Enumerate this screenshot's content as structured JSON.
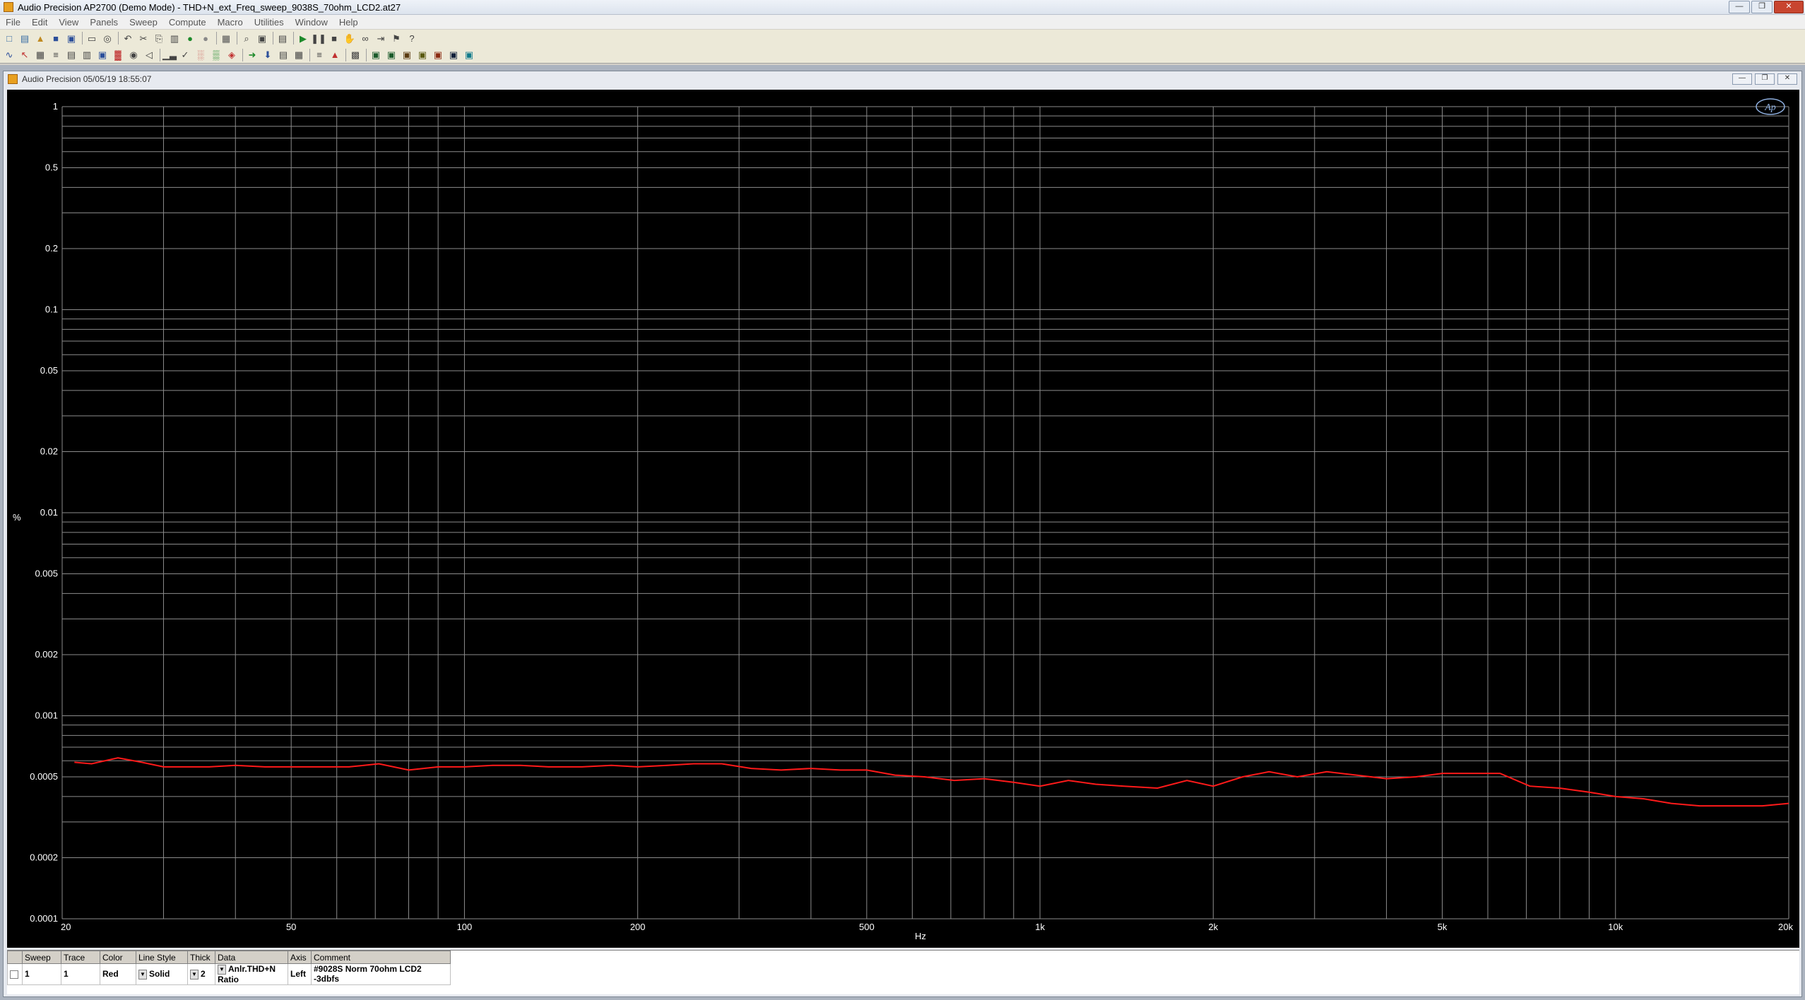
{
  "app": {
    "title": "Audio Precision AP2700 (Demo Mode) - THD+N_ext_Freq_sweep_9038S_70ohm_LCD2.at27",
    "window_buttons": [
      "—",
      "❐",
      "✕"
    ]
  },
  "menu": [
    "File",
    "Edit",
    "View",
    "Panels",
    "Sweep",
    "Compute",
    "Macro",
    "Utilities",
    "Window",
    "Help"
  ],
  "toolbar1": [
    {
      "name": "new-icon",
      "glyph": "□",
      "color": "#3a6ea5"
    },
    {
      "name": "open-settings-icon",
      "glyph": "▤",
      "color": "#3a6ea5"
    },
    {
      "name": "open-icon",
      "glyph": "▲",
      "color": "#c08a20"
    },
    {
      "name": "save-icon",
      "glyph": "■",
      "color": "#2c4f9a"
    },
    {
      "name": "save-all-icon",
      "glyph": "▣",
      "color": "#2c4f9a"
    },
    {
      "sep": true
    },
    {
      "name": "print-icon",
      "glyph": "▭",
      "color": "#444"
    },
    {
      "name": "print-preview-icon",
      "glyph": "◎",
      "color": "#444"
    },
    {
      "sep": true
    },
    {
      "name": "undo-icon",
      "glyph": "↶",
      "color": "#444"
    },
    {
      "name": "cut-icon",
      "glyph": "✂",
      "color": "#444"
    },
    {
      "name": "copy-icon",
      "glyph": "⎘",
      "color": "#444"
    },
    {
      "name": "paste-icon",
      "glyph": "▥",
      "color": "#444"
    },
    {
      "name": "generator-on-icon",
      "glyph": "●",
      "color": "#1d8a2a"
    },
    {
      "name": "generator-off-icon",
      "glyph": "●",
      "color": "#888"
    },
    {
      "sep": true
    },
    {
      "name": "panel-icon",
      "glyph": "▦",
      "color": "#555"
    },
    {
      "sep": true
    },
    {
      "name": "find-icon",
      "glyph": "⌕",
      "color": "#444"
    },
    {
      "name": "window-icon",
      "glyph": "▣",
      "color": "#444"
    },
    {
      "sep": true
    },
    {
      "name": "settings-icon",
      "glyph": "▤",
      "color": "#444"
    },
    {
      "sep": true
    },
    {
      "name": "play-icon",
      "glyph": "▶",
      "color": "#1d8a2a"
    },
    {
      "name": "pause-icon",
      "glyph": "❚❚",
      "color": "#444"
    },
    {
      "name": "stop-icon",
      "glyph": "■",
      "color": "#444"
    },
    {
      "name": "hand-icon",
      "glyph": "✋",
      "color": "#444"
    },
    {
      "name": "binoculars-icon",
      "glyph": "∞",
      "color": "#444"
    },
    {
      "name": "step-icon",
      "glyph": "⇥",
      "color": "#444"
    },
    {
      "name": "marker-icon",
      "glyph": "⚑",
      "color": "#444"
    },
    {
      "name": "help-icon",
      "glyph": "?",
      "color": "#444"
    }
  ],
  "toolbar2": [
    {
      "name": "graph-icon",
      "glyph": "∿",
      "color": "#2c4f9a"
    },
    {
      "name": "cursor-icon",
      "glyph": "↖",
      "color": "#c03030"
    },
    {
      "name": "scale-icon",
      "glyph": "▦",
      "color": "#444"
    },
    {
      "name": "analyzer-icon",
      "glyph": "≡",
      "color": "#444"
    },
    {
      "name": "generator-icon",
      "glyph": "▤",
      "color": "#444"
    },
    {
      "name": "filter-icon",
      "glyph": "▥",
      "color": "#444"
    },
    {
      "name": "meter-icon",
      "glyph": "▣",
      "color": "#2c4f9a"
    },
    {
      "name": "switcher-icon",
      "glyph": "▓",
      "color": "#c03030"
    },
    {
      "name": "dsp-icon",
      "glyph": "◉",
      "color": "#444"
    },
    {
      "name": "speaker-icon",
      "glyph": "◁",
      "color": "#444"
    },
    {
      "sep": true
    },
    {
      "name": "bar-icon",
      "glyph": "▁▃",
      "color": "#444"
    },
    {
      "name": "check-icon",
      "glyph": "✓",
      "color": "#444"
    },
    {
      "name": "fft-icon",
      "glyph": "░",
      "color": "#c03030"
    },
    {
      "name": "limits-icon",
      "glyph": "▒",
      "color": "#1d8a2a"
    },
    {
      "name": "regulate-icon",
      "glyph": "◈",
      "color": "#c03030"
    },
    {
      "sep": true
    },
    {
      "name": "import-icon",
      "glyph": "➜",
      "color": "#1d8a2a"
    },
    {
      "name": "download-icon",
      "glyph": "⬇",
      "color": "#2c4f9a"
    },
    {
      "name": "chart-icon",
      "glyph": "▤",
      "color": "#444"
    },
    {
      "name": "table-icon",
      "glyph": "▦",
      "color": "#444"
    },
    {
      "sep": true
    },
    {
      "name": "sweep-table-icon",
      "glyph": "≡",
      "color": "#444"
    },
    {
      "name": "trigger-icon",
      "glyph": "▲",
      "color": "#c03030"
    },
    {
      "sep": true
    },
    {
      "name": "spectrum-icon",
      "glyph": "▩",
      "color": "#444"
    },
    {
      "sep": true
    },
    {
      "name": "display-1-icon",
      "glyph": "▣",
      "color": "#1a5a2a"
    },
    {
      "name": "display-2-icon",
      "glyph": "▣",
      "color": "#1a5a2a"
    },
    {
      "name": "display-3-icon",
      "glyph": "▣",
      "color": "#5a3a10"
    },
    {
      "name": "display-4-icon",
      "glyph": "▣",
      "color": "#5a5a10"
    },
    {
      "name": "display-5-icon",
      "glyph": "▣",
      "color": "#8a2a10"
    },
    {
      "name": "display-6-icon",
      "glyph": "▣",
      "color": "#10203a"
    },
    {
      "name": "display-7-icon",
      "glyph": "▣",
      "color": "#107a8a"
    }
  ],
  "graph_window": {
    "title": "Audio Precision  05/05/19 18:55:07",
    "buttons": [
      "—",
      "❐",
      "✕"
    ],
    "logo_text": "Ap"
  },
  "chart_data": {
    "type": "line",
    "title": "",
    "xlabel": "Hz",
    "ylabel": "%",
    "x_scale": "log",
    "y_scale": "log",
    "xlim": [
      20,
      20000
    ],
    "ylim": [
      0.0001,
      1
    ],
    "x_ticks": [
      20,
      50,
      100,
      200,
      500,
      1000,
      2000,
      5000,
      10000,
      20000
    ],
    "x_tick_labels": [
      "20",
      "50",
      "100",
      "200",
      "500",
      "1k",
      "2k",
      "5k",
      "10k",
      "20k"
    ],
    "y_ticks": [
      1,
      0.5,
      0.2,
      0.1,
      0.05,
      0.02,
      0.01,
      0.005,
      0.002,
      0.001,
      0.0005,
      0.0002,
      0.0001
    ],
    "y_tick_labels": [
      "1",
      "0.5",
      "0.2",
      "0.1",
      "0.05",
      "0.02",
      "0.01",
      "0.005",
      "0.002",
      "0.001",
      "0.0005",
      "0.0002",
      "0.0001"
    ],
    "grid": true,
    "background": "#000000",
    "grid_color": "#8c8c8c",
    "series": [
      {
        "color": "#ff1a1a",
        "x": [
          21,
          22.5,
          25,
          27.5,
          30,
          33,
          36,
          40,
          45,
          50,
          56,
          63,
          71,
          80,
          90,
          100,
          112,
          125,
          140,
          160,
          180,
          200,
          225,
          250,
          280,
          315,
          355,
          400,
          450,
          500,
          560,
          630,
          710,
          800,
          900,
          1000,
          1120,
          1250,
          1400,
          1600,
          1800,
          2000,
          2250,
          2500,
          2800,
          3150,
          3550,
          4000,
          4500,
          5000,
          5600,
          6300,
          7100,
          8000,
          9000,
          10000,
          11200,
          12500,
          14000,
          16000,
          18000,
          20000
        ],
        "y": [
          0.00059,
          0.00058,
          0.00062,
          0.00059,
          0.00056,
          0.00056,
          0.00056,
          0.00057,
          0.00056,
          0.00056,
          0.00056,
          0.00056,
          0.00058,
          0.00054,
          0.00056,
          0.00056,
          0.00057,
          0.00057,
          0.00056,
          0.00056,
          0.00057,
          0.00056,
          0.00057,
          0.00058,
          0.00058,
          0.00055,
          0.00054,
          0.00055,
          0.00054,
          0.00054,
          0.00051,
          0.0005,
          0.00048,
          0.00049,
          0.00047,
          0.00045,
          0.00048,
          0.00046,
          0.00045,
          0.00044,
          0.00048,
          0.00045,
          0.0005,
          0.00053,
          0.0005,
          0.00053,
          0.00051,
          0.00049,
          0.0005,
          0.00052,
          0.00052,
          0.00052,
          0.00045,
          0.00044,
          0.00042,
          0.0004,
          0.00039,
          0.00037,
          0.00036,
          0.00036,
          0.00036,
          0.00037
        ]
      }
    ]
  },
  "trace_table": {
    "headers": [
      "Sweep",
      "Trace",
      "Color",
      "Line Style",
      "Thick",
      "Data",
      "Axis",
      "Comment"
    ],
    "rows": [
      {
        "sweep": "1",
        "trace": "1",
        "color": "Red",
        "line_style": "Solid",
        "thick": "2",
        "data": "Anlr.THD+N Ratio",
        "axis": "Left",
        "comment": "#9028S Norm 70ohm LCD2 -3dbfs"
      }
    ]
  }
}
